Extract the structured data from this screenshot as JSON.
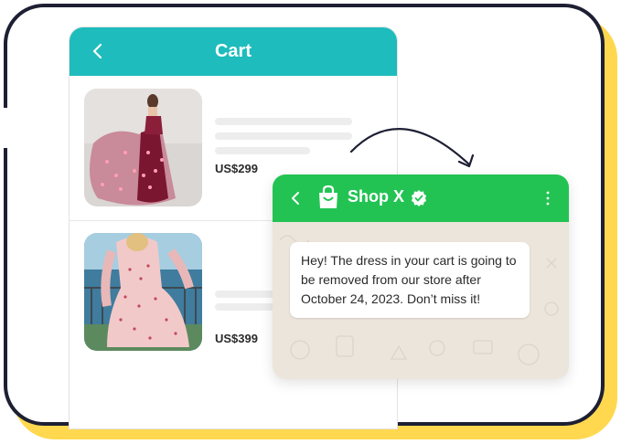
{
  "cart": {
    "title": "Cart",
    "items": [
      {
        "price": "US$299"
      },
      {
        "price": "US$399"
      }
    ]
  },
  "chat": {
    "shop_name": "Shop X",
    "message": "Hey! The dress in your cart is going to be removed from our store after October 24, 2023. Don’t miss it!"
  },
  "colors": {
    "cart_header": "#1ebcbc",
    "chat_header": "#22c353",
    "frame_border": "#1d1f33",
    "frame_shadow": "#ffd84f",
    "chat_background": "#ece5dc"
  },
  "icons": [
    "chevron-left-icon",
    "shopping-bag-icon",
    "verified-badge-icon",
    "more-vertical-icon",
    "curved-arrow-icon"
  ]
}
